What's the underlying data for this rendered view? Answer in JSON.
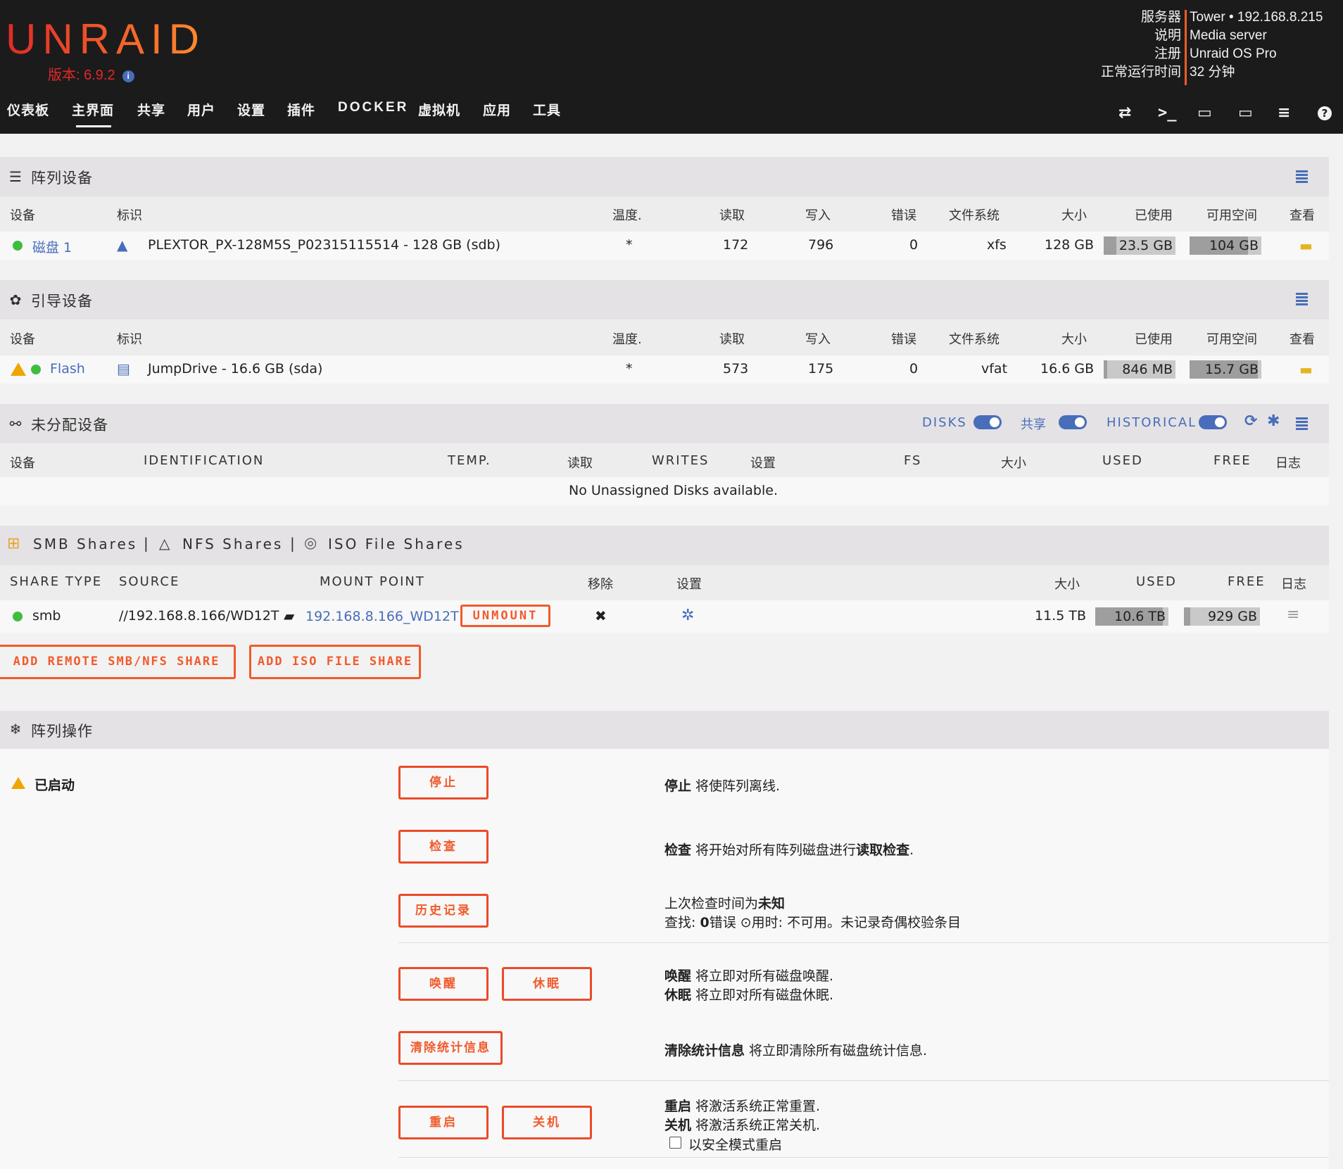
{
  "header": {
    "logo": "UNRAID",
    "version": "版本: 6.9.2",
    "server_label": "服务器",
    "server_value": "Tower • 192.168.8.215",
    "desc_label": "说明",
    "desc_value": "Media server",
    "reg_label": "注册",
    "reg_value": "Unraid OS Pro",
    "uptime_label": "正常运行时间",
    "uptime_value": "32 分钟"
  },
  "nav": [
    "仪表板",
    "主界面",
    "共享",
    "用户",
    "设置",
    "插件",
    "DOCKER",
    "虚拟机",
    "应用",
    "工具"
  ],
  "array": {
    "title": "阵列设备",
    "headers": [
      "设备",
      "标识",
      "温度.",
      "读取",
      "写入",
      "错误",
      "文件系统",
      "大小",
      "已使用",
      "可用空间",
      "查看"
    ],
    "row": {
      "device": "磁盘 1",
      "id": "PLEXTOR_PX-128M5S_P02315115514 - 128 GB (sdb)",
      "temp": "*",
      "reads": "172",
      "writes": "796",
      "errors": "0",
      "fs": "xfs",
      "size": "128 GB",
      "used": "23.5 GB",
      "free": "104 GB",
      "used_frac": 0.18,
      "free_frac": 0.81
    }
  },
  "boot": {
    "title": "引导设备",
    "headers": [
      "设备",
      "标识",
      "温度.",
      "读取",
      "写入",
      "错误",
      "文件系统",
      "大小",
      "已使用",
      "可用空间",
      "查看"
    ],
    "row": {
      "device": "Flash",
      "id": "JumpDrive - 16.6 GB (sda)",
      "temp": "*",
      "reads": "573",
      "writes": "175",
      "errors": "0",
      "fs": "vfat",
      "size": "16.6 GB",
      "used": "846 MB",
      "free": "15.7 GB",
      "used_frac": 0.05,
      "free_frac": 0.95
    }
  },
  "unassigned": {
    "title": "未分配设备",
    "toggles": [
      "DISKS",
      "共享",
      "HISTORICAL"
    ],
    "headers": [
      "设备",
      "IDENTIFICATION",
      "TEMP.",
      "读取",
      "WRITES",
      "设置",
      "FS",
      "大小",
      "USED",
      "FREE",
      "日志"
    ],
    "empty": "No Unassigned Disks available."
  },
  "shares": {
    "tabs": [
      "SMB Shares",
      "NFS Shares",
      "ISO File Shares"
    ],
    "sep": "|",
    "headers": [
      "SHARE TYPE",
      "SOURCE",
      "MOUNT POINT",
      "移除",
      "设置",
      "大小",
      "USED",
      "FREE",
      "日志"
    ],
    "row": {
      "type": "smb",
      "source": "//192.168.8.166/WD12T",
      "mount": "192.168.8.166_WD12T",
      "unmount": "UNMOUNT",
      "size": "11.5 TB",
      "used": "10.6 TB",
      "free": "929 GB",
      "used_frac": 0.92,
      "free_frac": 0.08
    },
    "add_remote": "ADD REMOTE SMB/NFS SHARE",
    "add_iso": "ADD ISO FILE SHARE"
  },
  "ops": {
    "title": "阵列操作",
    "status": "已启动",
    "stop": "停止",
    "check": "检查",
    "history": "历史记录",
    "spinup": "唤醒",
    "spindown": "休眠",
    "clearstats": "清除统计信息",
    "reboot": "重启",
    "shutdown": "关机",
    "stop_b": "停止",
    "stop_t": " 将使阵列离线.",
    "check_b": "检查",
    "check_t1": " 将开始对所有阵列磁盘进行",
    "check_b2": "读取检查",
    "check_t2": ".",
    "last_t": "上次检查时间为",
    "last_b": "未知",
    "find_t1": "查找: ",
    "find_b": "0",
    "find_t2": "错误 ",
    "find_t3": "用时: 不可用。未记录奇偶校验条目",
    "up_b": "唤醒",
    "up_t": " 将立即对所有磁盘唤醒.",
    "down_b": "休眠",
    "down_t": " 将立即对所有磁盘休眠.",
    "clr_b": "清除统计信息",
    "clr_t": " 将立即清除所有磁盘统计信息.",
    "rb_b": "重启",
    "rb_t": " 将激活系统正常重置.",
    "sd_b": "关机",
    "sd_t": " 将激活系统正常关机.",
    "safe": "以安全模式重启"
  }
}
